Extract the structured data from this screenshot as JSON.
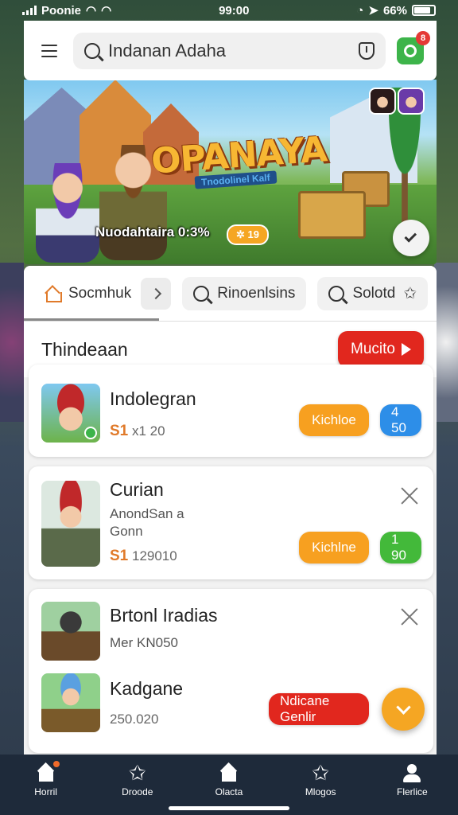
{
  "status_bar": {
    "carrier": "Poonie",
    "time": "99:00",
    "battery": "66%"
  },
  "header": {
    "search_value": "Indanan Adaha",
    "notification_count": "8"
  },
  "banner": {
    "title": "OPANAYA",
    "subtitle": "Tnodolinel Kalf",
    "stat": "Nuodahtaira 0:3%",
    "chip": "✲ 19"
  },
  "tabs": [
    {
      "label": "Socmhuk",
      "icon": "house-icon"
    },
    {
      "label": "Rinoenlsins",
      "icon": "search-icon"
    },
    {
      "label": "Solotd",
      "icon": "star-icon"
    }
  ],
  "section": {
    "title": "Thindeaan",
    "more_label": "Mucito"
  },
  "cards": [
    {
      "title": "Indolegran",
      "price_currency": "S1",
      "price_value": "x1 20",
      "primary_action": "Kichloe",
      "secondary_action": "4 50"
    },
    {
      "title": "Curian",
      "subtitle_1": "AnondSan a",
      "subtitle_2": "Gonn",
      "price_currency": "S1",
      "price_value": "129010",
      "primary_action": "Kichlne",
      "secondary_action": "1 90"
    },
    {
      "title": "Brtonl Iradias",
      "subtitle": "Mer KN050"
    },
    {
      "title": "Kadgane",
      "price_value": "250.020",
      "primary_action": "Ndicane Genlir"
    }
  ],
  "bottom_nav": [
    {
      "label": "Horril",
      "icon": "home-icon"
    },
    {
      "label": "Droode",
      "icon": "star-icon"
    },
    {
      "label": "Olacta",
      "icon": "house-icon"
    },
    {
      "label": "Mlogos",
      "icon": "star-icon"
    },
    {
      "label": "Flerlice",
      "icon": "user-icon"
    }
  ],
  "colors": {
    "accent_red": "#e1271e",
    "accent_orange": "#f7a020",
    "accent_blue": "#2d8ee8",
    "accent_green": "#43b93a",
    "nav_bg": "#1e2a3a"
  }
}
